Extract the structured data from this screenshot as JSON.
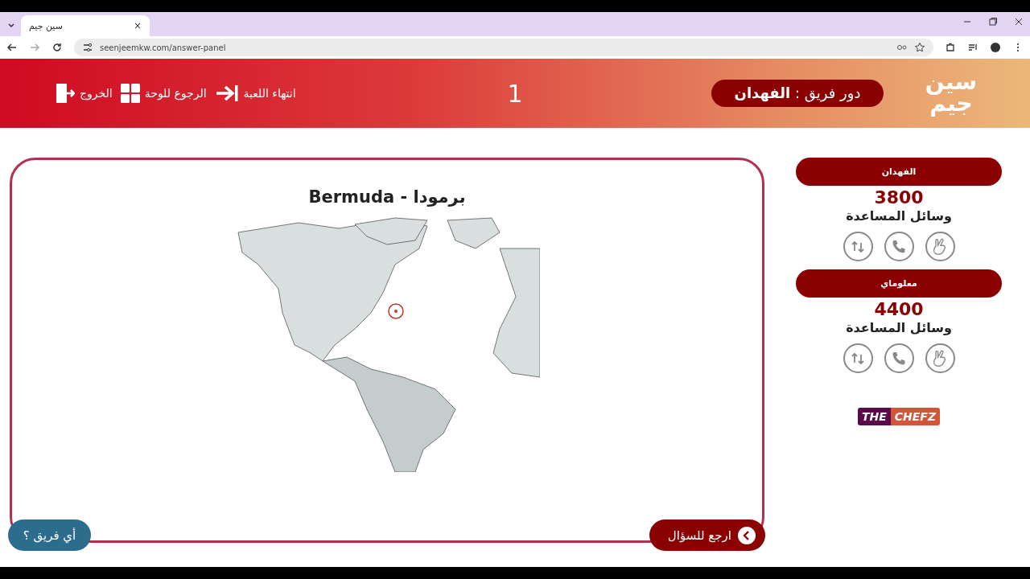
{
  "browser": {
    "tab": {
      "title": "سين جيم",
      "close": "×"
    },
    "url": "seenjeemkw.com/answer-panel"
  },
  "header": {
    "logo": "سين جيم",
    "turn": "دور فريق : **الفهدان**",
    "question_number": "1",
    "actions": [
      {
        "kind": "end",
        "label": "انتهاء اللعبة"
      },
      {
        "kind": "board",
        "label": "الرجوع للوحة"
      },
      {
        "kind": "exit",
        "label": "الخروج"
      }
    ]
  },
  "teams": [
    {
      "name": "الفهدان",
      "score": "3800",
      "aids_label": "وسائل المساعدة",
      "aids": [
        {
          "kind": "two-answers"
        },
        {
          "kind": "call"
        },
        {
          "kind": "swap"
        }
      ]
    },
    {
      "name": "معلوماي",
      "score": "4400",
      "aids_label": "وسائل المساعدة",
      "aids": [
        {
          "kind": "two-answers"
        },
        {
          "kind": "call"
        },
        {
          "kind": "swap"
        }
      ]
    }
  ],
  "sponsor": {
    "first": "THE",
    "second": "CHEFZ"
  },
  "answer": {
    "title": "Bermuda - برمودا"
  },
  "buttons": [
    {
      "kind": "back",
      "label": "ارجع للسؤال"
    },
    {
      "kind": "which-team",
      "label": "أي فريق ؟"
    }
  ]
}
